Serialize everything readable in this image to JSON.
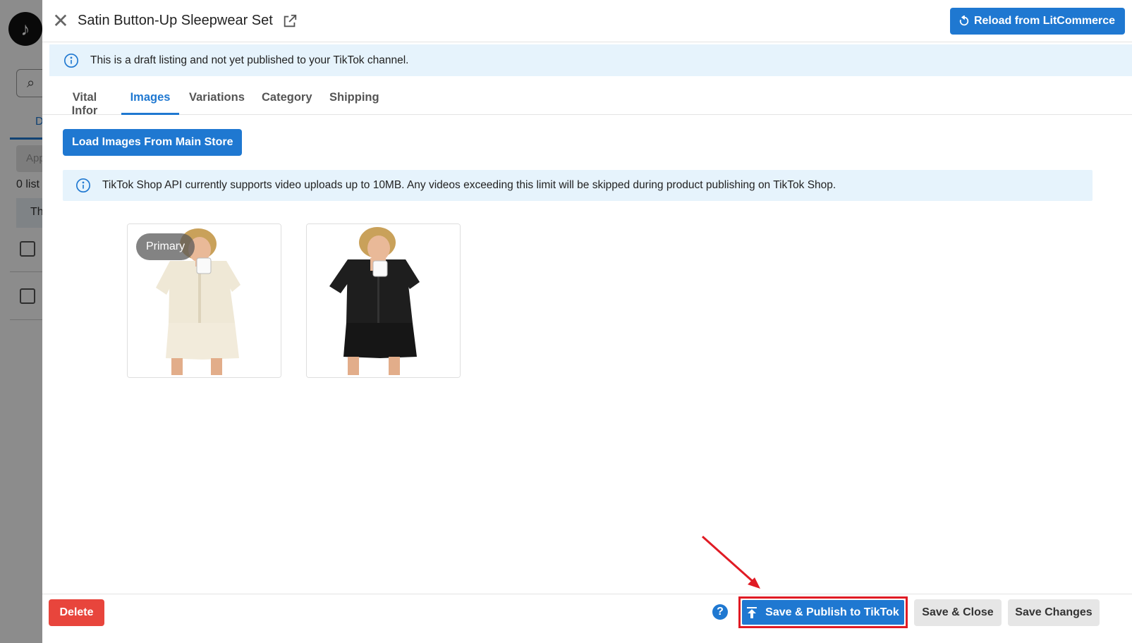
{
  "background": {
    "logo_glyph": "♪",
    "search_icon": "search-icon",
    "tab_label_partial": "D",
    "apply_button_partial": "App",
    "listing_count_partial": "0 list",
    "table_header_partial": "Th"
  },
  "modal": {
    "title": "Satin Button-Up Sleepwear Set",
    "close_glyph": "✕",
    "reload_label": "Reload from LitCommerce",
    "draft_notice": "This is a draft listing and not yet published to your TikTok channel.",
    "tabs": [
      {
        "label": "Vital Infor",
        "active": false
      },
      {
        "label": "Images",
        "active": true
      },
      {
        "label": "Variations",
        "active": false
      },
      {
        "label": "Category",
        "active": false
      },
      {
        "label": "Shipping",
        "active": false
      }
    ],
    "load_images_label": "Load Images From Main Store",
    "api_notice": "TikTok Shop API currently supports video uploads up to 10MB. Any videos exceeding this limit will be skipped during product publishing on TikTok Shop.",
    "images": [
      {
        "badge": "Primary",
        "color": "cream"
      },
      {
        "badge": "",
        "color": "black"
      }
    ]
  },
  "footer": {
    "delete_label": "Delete",
    "help_glyph": "?",
    "publish_label": "Save & Publish to TikTok",
    "save_close_label": "Save & Close",
    "save_changes_label": "Save Changes"
  },
  "colors": {
    "primary": "#1f78d1",
    "danger": "#e8453c",
    "highlight_border": "#e01b24",
    "info_bg": "#e6f3fc"
  }
}
